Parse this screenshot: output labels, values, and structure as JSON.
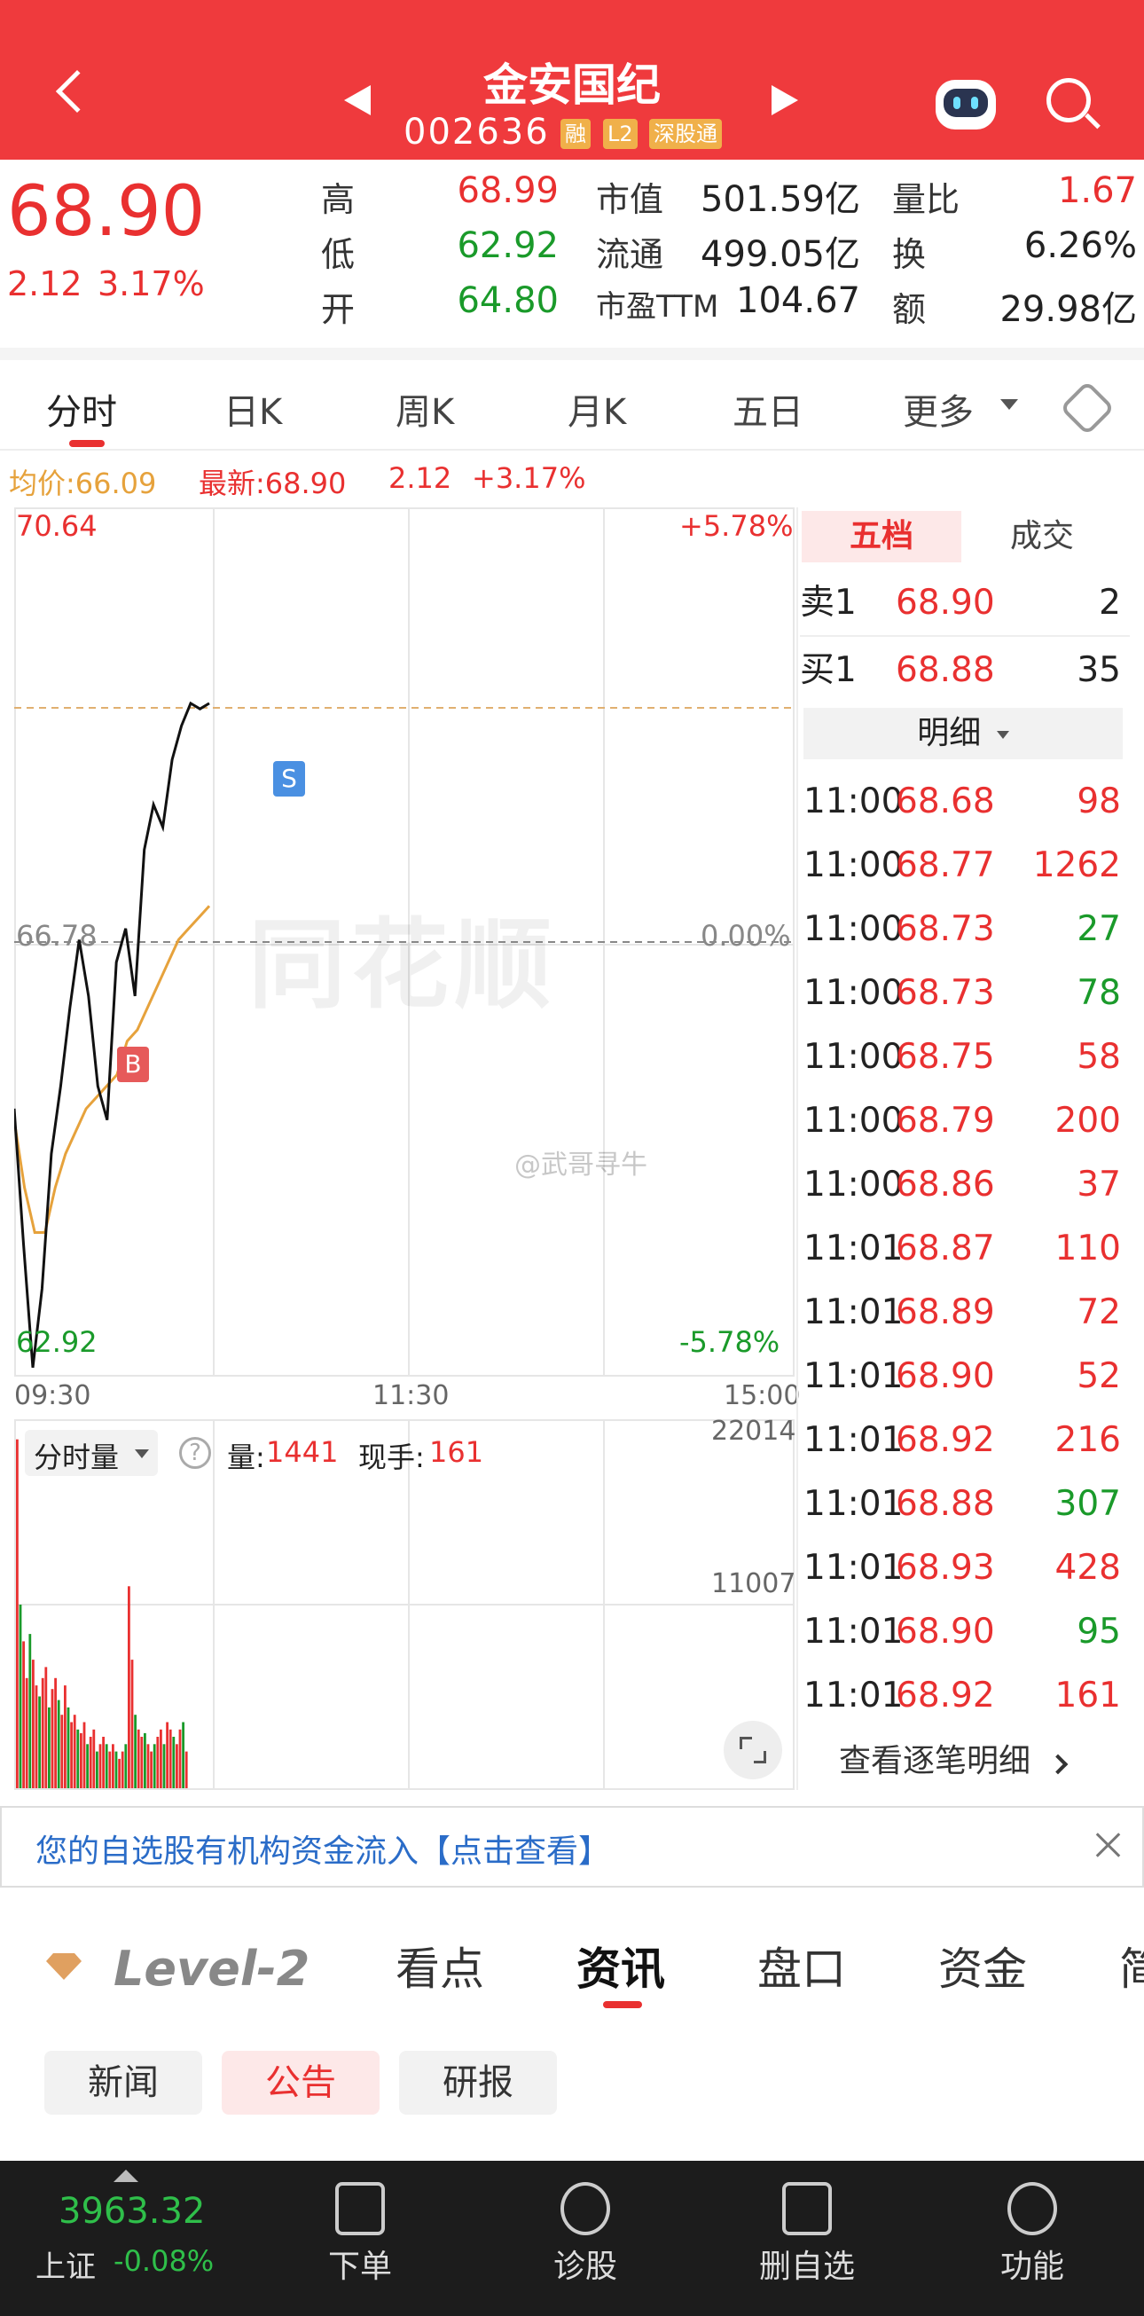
{
  "header": {
    "back_icon": "chevron-left-icon",
    "title": "金安国纪",
    "code": "002636",
    "badges": [
      "融",
      "L2",
      "深股通"
    ],
    "prev_icon": "triangle-left-icon",
    "next_icon": "triangle-right-icon",
    "robot_icon": "robot-assistant-icon",
    "search_icon": "search-icon"
  },
  "quote": {
    "price": "68.90",
    "change": "2.12",
    "change_pct": "3.17%",
    "stats": [
      {
        "label": "高",
        "value": "68.99",
        "label2": "市值",
        "value2": "501.59亿",
        "label3": "量比",
        "value3": "1.67"
      },
      {
        "label": "低",
        "value": "62.92",
        "label2": "流通",
        "value2": "499.05亿",
        "label3": "换",
        "value3": "6.26%"
      },
      {
        "label": "开",
        "value": "64.80",
        "label2": "市盈TTM",
        "value2": "104.67",
        "label3": "额",
        "value3": "29.98亿"
      }
    ]
  },
  "tabs": {
    "items": [
      "分时",
      "日K",
      "周K",
      "月K",
      "五日",
      "更多"
    ],
    "active": "分时",
    "settings_icon": "hexagon-settings-icon"
  },
  "info_line": {
    "avg_label": "均价:66.09",
    "latest_label": "最新:68.90",
    "change": "2.12",
    "change_pct": "+3.17%"
  },
  "chart_data": {
    "type": "line",
    "y_top": "70.64",
    "y_mid": "66.78",
    "y_bottom": "62.92",
    "pct_top": "+5.78%",
    "pct_mid": "0.00%",
    "pct_bottom": "-5.78%",
    "x_labels": [
      "09:30",
      "11:30",
      "15:00"
    ],
    "ylim": [
      62.92,
      70.64
    ],
    "watermark": "同花顺",
    "weibo_mark": "@武哥寻牛",
    "markers": [
      {
        "label": "B",
        "price": 65.4
      },
      {
        "label": "S",
        "price": 69.0
      }
    ],
    "price_series": [
      65.3,
      64.1,
      63.0,
      63.7,
      64.9,
      65.5,
      66.2,
      66.8,
      66.3,
      65.5,
      65.2,
      66.6,
      66.9,
      66.3,
      67.6,
      68.0,
      67.8,
      68.4,
      68.7,
      68.9,
      68.85,
      68.9
    ],
    "avg_series": [
      65.2,
      64.6,
      64.2,
      64.2,
      64.6,
      64.9,
      65.1,
      65.3,
      65.4,
      65.5,
      65.6,
      65.9,
      66.0,
      66.2,
      66.4,
      66.6,
      66.8,
      66.9,
      67.0,
      67.1
    ]
  },
  "volume": {
    "selector": "分时量",
    "help_icon": "question-circle-icon",
    "vol_label": "量:",
    "vol_value": "1441",
    "hand_label": "现手:",
    "hand_value": "161",
    "max_label": "22014",
    "mid_label": "11007",
    "expand_icon": "expand-icon",
    "bars": [
      0.95,
      0.5,
      0.4,
      0.3,
      0.42,
      0.35,
      0.28,
      0.25,
      0.3,
      0.33,
      0.22,
      0.27,
      0.3,
      0.24,
      0.2,
      0.28,
      0.22,
      0.18,
      0.2,
      0.16,
      0.15,
      0.18,
      0.12,
      0.14,
      0.16,
      0.1,
      0.12,
      0.14,
      0.12,
      0.1,
      0.12,
      0.1,
      0.08,
      0.1,
      0.12,
      0.55,
      0.35,
      0.2,
      0.16,
      0.14,
      0.15,
      0.12,
      0.1,
      0.12,
      0.14,
      0.16,
      0.12,
      0.18,
      0.16,
      0.14,
      0.12,
      0.16,
      0.18,
      0.1
    ]
  },
  "side_panel": {
    "tab_active": "五档",
    "tab_other": "成交",
    "ask": {
      "label": "卖1",
      "price": "68.90",
      "vol": "2"
    },
    "bid": {
      "label": "买1",
      "price": "68.88",
      "vol": "35"
    },
    "detail_title": "明细",
    "trades": [
      {
        "t": "11:00",
        "p": "68.68",
        "v": "98",
        "c": "red"
      },
      {
        "t": "11:00",
        "p": "68.77",
        "v": "1262",
        "c": "red"
      },
      {
        "t": "11:00",
        "p": "68.73",
        "v": "27",
        "c": "green"
      },
      {
        "t": "11:00",
        "p": "68.73",
        "v": "78",
        "c": "green"
      },
      {
        "t": "11:00",
        "p": "68.75",
        "v": "58",
        "c": "red"
      },
      {
        "t": "11:00",
        "p": "68.79",
        "v": "200",
        "c": "red"
      },
      {
        "t": "11:00",
        "p": "68.86",
        "v": "37",
        "c": "red"
      },
      {
        "t": "11:01",
        "p": "68.87",
        "v": "110",
        "c": "red"
      },
      {
        "t": "11:01",
        "p": "68.89",
        "v": "72",
        "c": "red"
      },
      {
        "t": "11:01",
        "p": "68.90",
        "v": "52",
        "c": "red"
      },
      {
        "t": "11:01",
        "p": "68.92",
        "v": "216",
        "c": "red"
      },
      {
        "t": "11:01",
        "p": "68.88",
        "v": "307",
        "c": "green"
      },
      {
        "t": "11:01",
        "p": "68.93",
        "v": "428",
        "c": "red"
      },
      {
        "t": "11:01",
        "p": "68.90",
        "v": "95",
        "c": "green"
      },
      {
        "t": "11:01",
        "p": "68.92",
        "v": "161",
        "c": "red"
      }
    ],
    "view_all": "查看逐笔明细"
  },
  "banner": {
    "text": "您的自选股有机构资金流入【点击查看】",
    "close_icon": "close-icon"
  },
  "bottom_tabs": {
    "level2": "Level-2",
    "items": [
      "看点",
      "资讯",
      "盘口",
      "资金",
      "简"
    ],
    "active": "资讯"
  },
  "subtabs": {
    "items": [
      "新闻",
      "公告",
      "研报"
    ],
    "active": "公告"
  },
  "footer": {
    "index_value": "3963.32",
    "index_name": "上证",
    "index_change": "-0.08%",
    "items": [
      {
        "label": "下单",
        "icon": "document-icon"
      },
      {
        "label": "诊股",
        "icon": "star-badge-icon"
      },
      {
        "label": "删自选",
        "icon": "minus-box-icon"
      },
      {
        "label": "功能",
        "icon": "menu-circle-icon"
      }
    ]
  },
  "colors": {
    "red": "#e93030",
    "green": "#1a9a2a",
    "header": "#ef3a3d",
    "avg_line": "#e6a23c"
  }
}
